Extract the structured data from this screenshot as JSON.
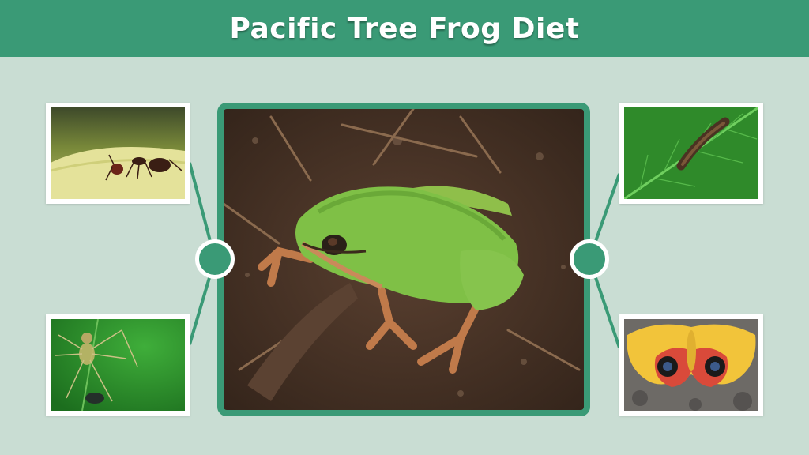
{
  "header": {
    "title": "Pacific Tree Frog Diet"
  },
  "colors": {
    "accent": "#3a9a76",
    "background": "#c9ddd3",
    "frame": "#ffffff"
  },
  "images": {
    "center": "pacific-tree-frog-photo",
    "top_left": "ant-photo",
    "bottom_left": "spider-photo",
    "top_right": "caterpillar-on-leaf-photo",
    "bottom_right": "io-moth-photo"
  }
}
